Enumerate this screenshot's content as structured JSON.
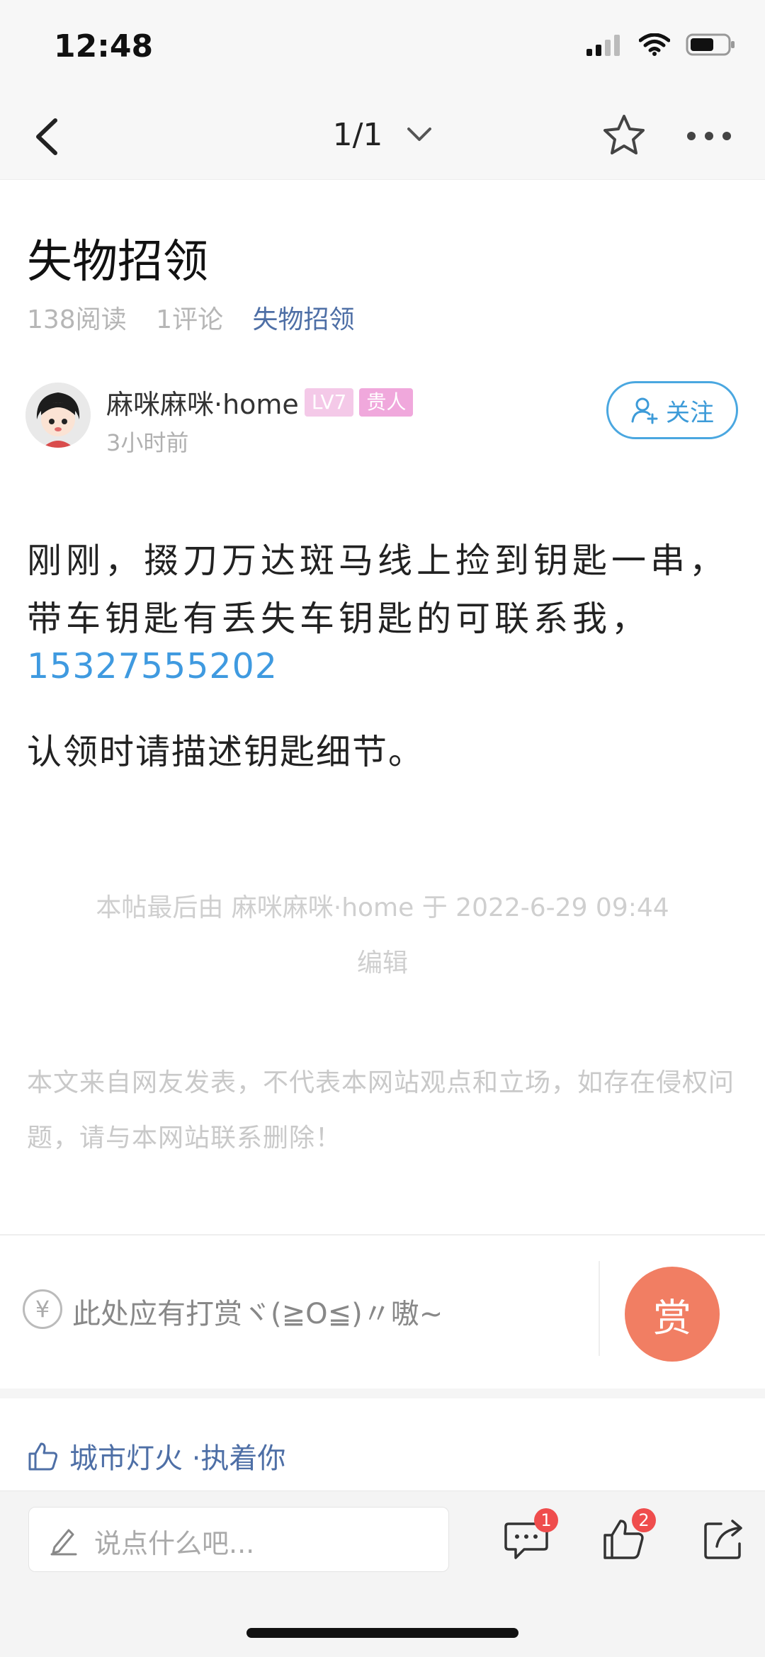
{
  "status": {
    "time": "12:48"
  },
  "nav": {
    "pager": "1/1"
  },
  "post": {
    "title": "失物招领",
    "reads": "138阅读",
    "comments": "1评论",
    "category": "失物招领"
  },
  "author": {
    "name": "麻咪麻咪·home",
    "level_badge": "LV7",
    "rank_badge": "贵人",
    "time": "3小时前",
    "follow_label": "关注"
  },
  "content": {
    "line1": "刚刚，掇刀万达斑马线上捡到钥匙一串，",
    "line2": "带车钥匙有丢失车钥匙的可联系我，",
    "phone": "15327555202",
    "line3": "认领时请描述钥匙细节。"
  },
  "edit_note": {
    "line1": "本帖最后由 麻咪麻咪·home 于 2022-6-29 09:44",
    "line2": "编辑"
  },
  "disclaimer": "本文来自网友发表，不代表本网站观点和立场，如存在侵权问题，请与本网站联系删除！",
  "reward": {
    "prompt": "此处应有打赏ヾ(≧O≦)〃嗷~",
    "button": "赏",
    "currency_symbol": "¥"
  },
  "likes": {
    "names": "城市灯火 ·执着你"
  },
  "bottom": {
    "comment_placeholder": "说点什么吧...",
    "comment_count": "1",
    "like_count": "2"
  },
  "colors": {
    "accent_blue": "#3f9ae0",
    "link_blue": "#4e6fa6",
    "reward_orange": "#f17e63",
    "badge_red": "#ef4d4d"
  }
}
